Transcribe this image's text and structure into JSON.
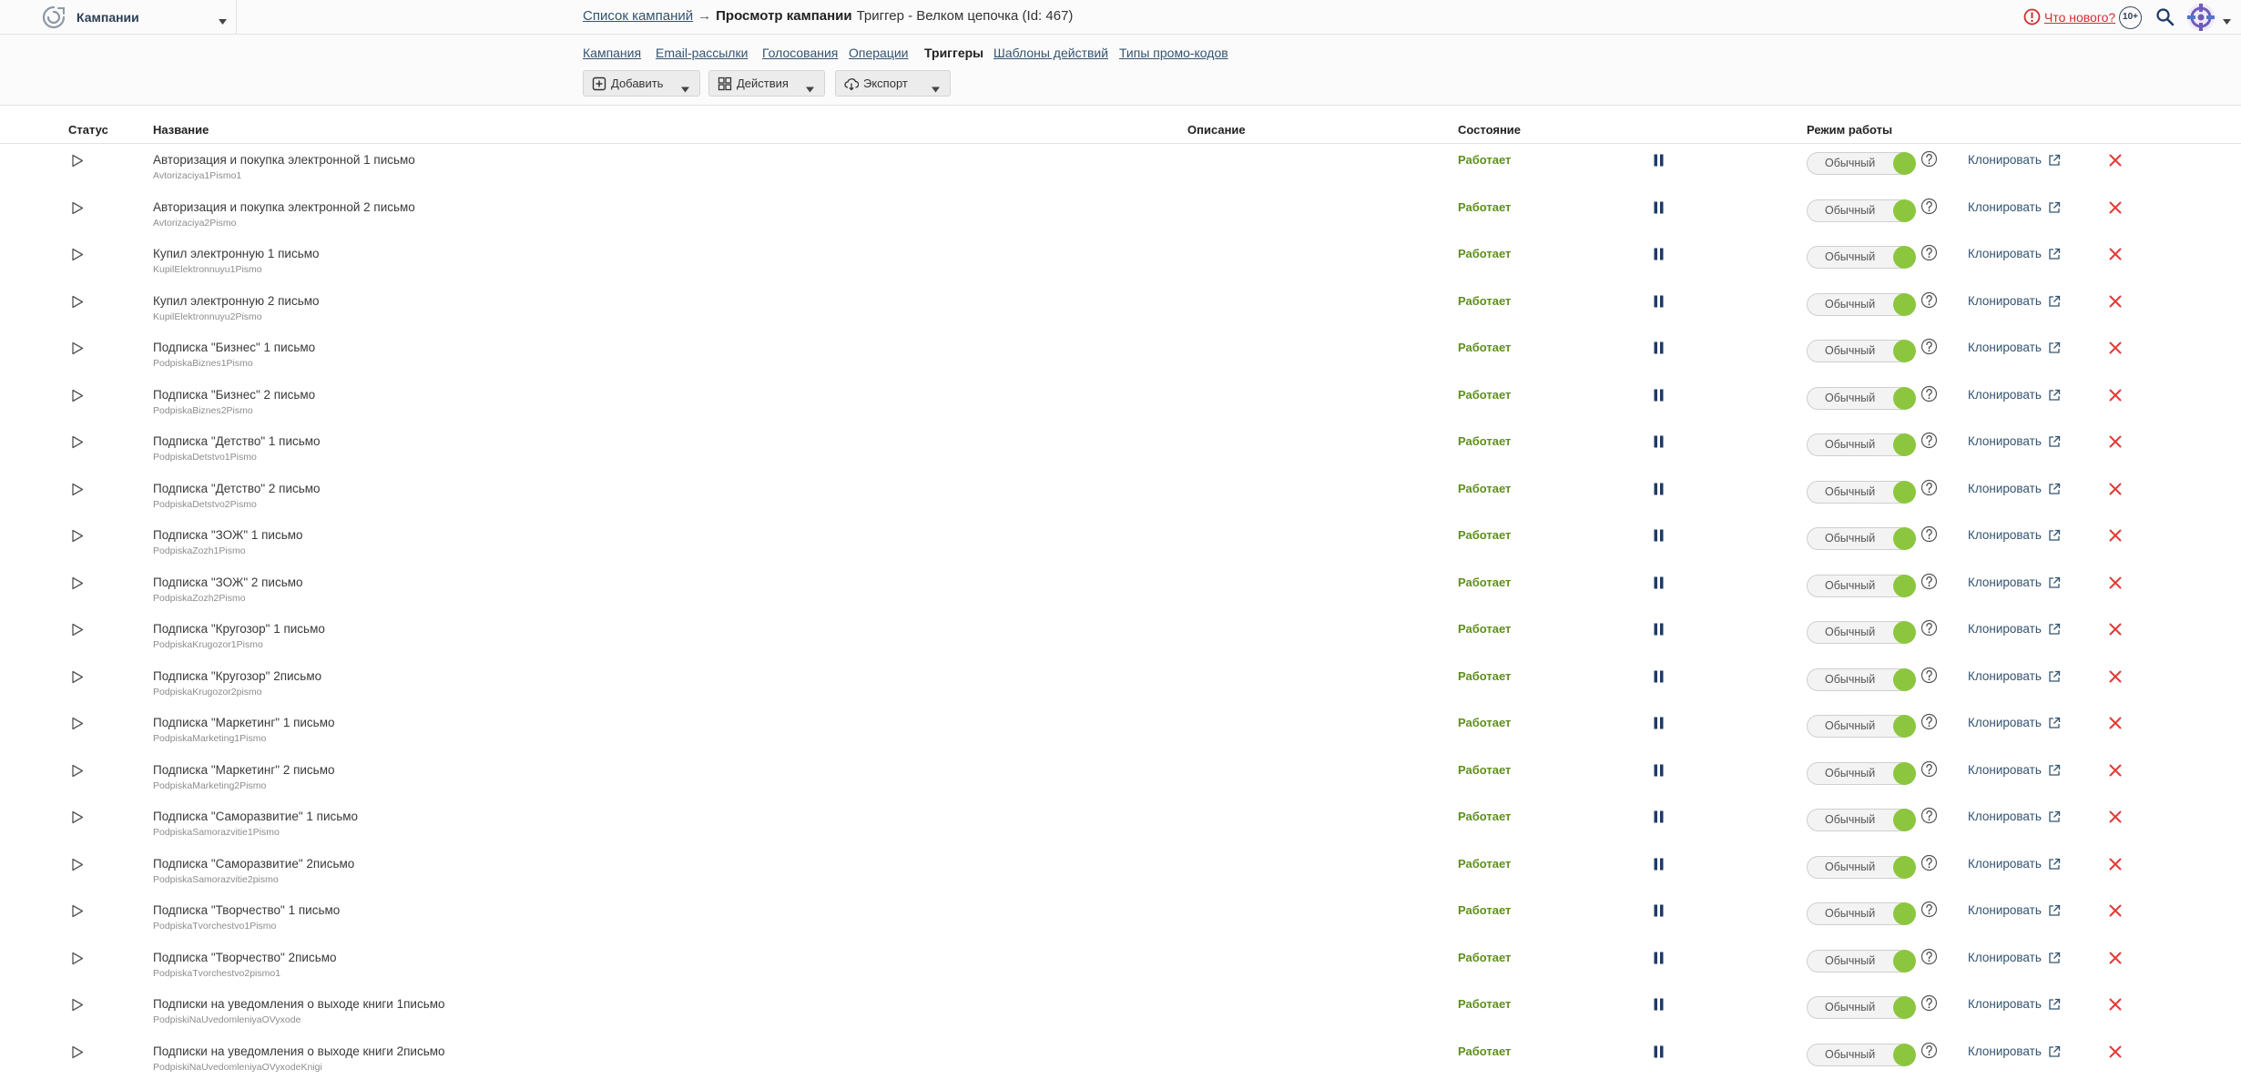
{
  "app": {
    "title": "Кампании"
  },
  "breadcrumb": {
    "link": "Список кампаний",
    "arrow": "→",
    "current_bold": "Просмотр кампании",
    "current_rest": "Триггер - Велком цепочка (Id: 467)"
  },
  "header_right": {
    "whats_new": "Что нового?",
    "badge": "10+"
  },
  "tabs": [
    {
      "label": "Кампания",
      "active": false
    },
    {
      "label": "Email-рассылки",
      "active": false
    },
    {
      "label": "Голосования",
      "active": false
    },
    {
      "label": "Операции",
      "active": false
    },
    {
      "label": "Триггеры",
      "active": true
    },
    {
      "label": "Шаблоны действий",
      "active": false
    },
    {
      "label": "Типы промо-кодов",
      "active": false
    }
  ],
  "toolbar": {
    "add_label": "Добавить",
    "actions_label": "Действия",
    "export_label": "Экспорт"
  },
  "table": {
    "columns": {
      "status": "Статус",
      "name": "Название",
      "description": "Описание",
      "state": "Состояние",
      "mode": "Режим работы"
    },
    "clone_label": "Клонировать"
  },
  "rows": [
    {
      "title": "Авторизация и покупка электронной 1 письмо",
      "code": "Avtorizaciya1Pismo1",
      "state": "Работает",
      "mode": "Обычный",
      "mode_switch_on": true
    },
    {
      "title": "Авторизация и покупка электронной 2 письмо",
      "code": "Avtorizaciya2Pismo",
      "state": "Работает",
      "mode": "Обычный",
      "mode_switch_on": true
    },
    {
      "title": "Купил электронную 1 письмо",
      "code": "KupilElektronnuyu1Pismo",
      "state": "Работает",
      "mode": "Обычный",
      "mode_switch_on": true
    },
    {
      "title": "Купил электронную 2 письмо",
      "code": "KupilElektronnuyu2Pismo",
      "state": "Работает",
      "mode": "Обычный",
      "mode_switch_on": true
    },
    {
      "title": "Подписка \"Бизнес\" 1 письмо",
      "code": "PodpiskaBiznes1Pismo",
      "state": "Работает",
      "mode": "Обычный",
      "mode_switch_on": true
    },
    {
      "title": "Подписка \"Бизнес\" 2 письмо",
      "code": "PodpiskaBiznes2Pismo",
      "state": "Работает",
      "mode": "Обычный",
      "mode_switch_on": true
    },
    {
      "title": "Подписка \"Детство\" 1 письмо",
      "code": "PodpiskaDetstvo1Pismo",
      "state": "Работает",
      "mode": "Обычный",
      "mode_switch_on": true
    },
    {
      "title": "Подписка \"Детство\" 2 письмо",
      "code": "PodpiskaDetstvo2Pismo",
      "state": "Работает",
      "mode": "Обычный",
      "mode_switch_on": true
    },
    {
      "title": "Подписка \"ЗОЖ\" 1 письмо",
      "code": "PodpiskaZozh1Pismo",
      "state": "Работает",
      "mode": "Обычный",
      "mode_switch_on": true
    },
    {
      "title": "Подписка \"ЗОЖ\" 2 письмо",
      "code": "PodpiskaZozh2Pismo",
      "state": "Работает",
      "mode": "Обычный",
      "mode_switch_on": true
    },
    {
      "title": "Подписка \"Кругозор\" 1 письмо",
      "code": "PodpiskaKrugozor1Pismo",
      "state": "Работает",
      "mode": "Обычный",
      "mode_switch_on": true
    },
    {
      "title": "Подписка \"Кругозор\" 2письмо",
      "code": "PodpiskaKrugozor2pismo",
      "state": "Работает",
      "mode": "Обычный",
      "mode_switch_on": true
    },
    {
      "title": "Подписка \"Маркетинг\" 1 письмо",
      "code": "PodpiskaMarketing1Pismo",
      "state": "Работает",
      "mode": "Обычный",
      "mode_switch_on": true
    },
    {
      "title": "Подписка \"Маркетинг\" 2 письмо",
      "code": "PodpiskaMarketing2Pismo",
      "state": "Работает",
      "mode": "Обычный",
      "mode_switch_on": true
    },
    {
      "title": "Подписка \"Саморазвитие\" 1 письмо",
      "code": "PodpiskaSamorazvitie1Pismo",
      "state": "Работает",
      "mode": "Обычный",
      "mode_switch_on": true
    },
    {
      "title": "Подписка \"Саморазвитие\" 2письмо",
      "code": "PodpiskaSamorazvitie2pismo",
      "state": "Работает",
      "mode": "Обычный",
      "mode_switch_on": true
    },
    {
      "title": "Подписка \"Творчество\" 1 письмо",
      "code": "PodpiskaTvorchestvo1Pismo",
      "state": "Работает",
      "mode": "Обычный",
      "mode_switch_on": true
    },
    {
      "title": "Подписка \"Творчество\" 2письмо",
      "code": "PodpiskaTvorchestvo2pismo1",
      "state": "Работает",
      "mode": "Обычный",
      "mode_switch_on": true
    },
    {
      "title": "Подписки на уведомления о выходе книги 1письмо",
      "code": "PodpiskiNaUvedomleniyaOVyxode",
      "state": "Работает",
      "mode": "Обычный",
      "mode_switch_on": true
    },
    {
      "title": "Подписки на уведомления о выходе книги 2письмо",
      "code": "PodpiskiNaUvedomleniyaOVyxodeKnigi",
      "state": "Работает",
      "mode": "Обычный",
      "mode_switch_on": true
    }
  ],
  "colors": {
    "state_green": "#5e8f1c",
    "knob_green": "#8cc63f",
    "delete_red": "#e53935",
    "link_blue": "#34536f",
    "whats_new_red": "#d32f2f",
    "pause_navy": "#1f3a66"
  },
  "icons": {
    "logo": "logo-icon",
    "app_menu": "chevron-down-icon",
    "whats_new": "alert-icon",
    "search": "search-icon",
    "user": "avatar",
    "add": "plus-square-icon",
    "actions": "grid-icon",
    "export": "cloud-download-icon",
    "row_status": "play-icon",
    "row_pause": "pause-icon",
    "row_help": "help-icon",
    "row_clone": "external-link-icon",
    "row_delete": "close-icon"
  }
}
